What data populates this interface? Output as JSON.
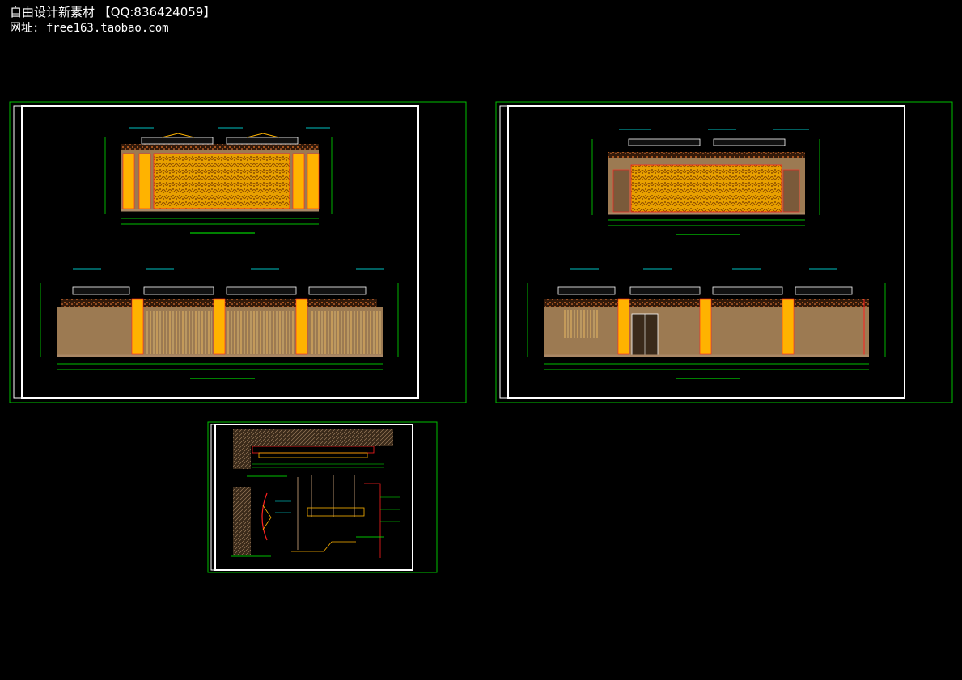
{
  "watermark": {
    "line1": "自由设计新素材  【QQ:836424059】",
    "line2": "网址: free163.taobao.com"
  },
  "colors": {
    "frame_green": "#00c000",
    "paper_white": "#ffffff",
    "dim_green": "#00ff00",
    "dim_cyan": "#00ffff",
    "wall_brown": "#9c7a52",
    "screen_yellow": "#e8a000",
    "pillar_orange": "#ffb300",
    "red_line": "#ff2020",
    "ceiling_pattern": "#cc6622"
  },
  "sheets": [
    {
      "id": "sheet-top-left",
      "content": "elevation drawings: carved screen wall (top) and curtain wall (bottom)"
    },
    {
      "id": "sheet-top-right",
      "content": "elevation drawings: carved screen wall with doors (top) and plain wall with door (bottom)"
    },
    {
      "id": "sheet-bottom",
      "content": "construction details: ceiling section and curtain box section"
    }
  ]
}
